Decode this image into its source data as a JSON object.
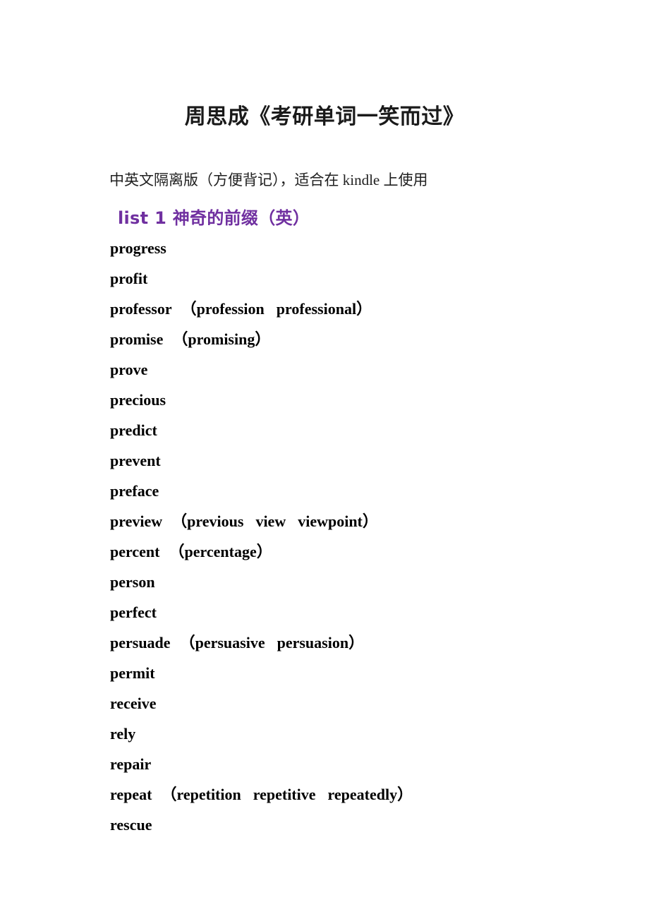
{
  "document": {
    "title": "周思成《考研单词一笑而过》",
    "subtitle": "中英文隔离版（方便背记），适合在 kindle 上使用",
    "section_heading": "list 1 神奇的前缀（英）",
    "heading_color": "#7030a0",
    "title_color": "#1a1a1a",
    "body_color": "#000000",
    "background_color": "#ffffff"
  },
  "word_list": [
    {
      "headword": "progress",
      "related": []
    },
    {
      "headword": "profit",
      "related": []
    },
    {
      "headword": "professor",
      "related": [
        "profession",
        "professional"
      ]
    },
    {
      "headword": "promise",
      "related": [
        "promising"
      ]
    },
    {
      "headword": "prove",
      "related": []
    },
    {
      "headword": "precious",
      "related": []
    },
    {
      "headword": "predict",
      "related": []
    },
    {
      "headword": "prevent",
      "related": []
    },
    {
      "headword": "preface",
      "related": []
    },
    {
      "headword": "preview",
      "related": [
        "previous",
        "view",
        "viewpoint"
      ]
    },
    {
      "headword": "percent",
      "related": [
        "percentage"
      ]
    },
    {
      "headword": "person",
      "related": []
    },
    {
      "headword": "perfect",
      "related": []
    },
    {
      "headword": "persuade",
      "related": [
        "persuasive",
        "persuasion"
      ]
    },
    {
      "headword": "permit",
      "related": []
    },
    {
      "headword": "receive",
      "related": []
    },
    {
      "headword": "rely",
      "related": []
    },
    {
      "headword": "repair",
      "related": []
    },
    {
      "headword": "repeat",
      "related": [
        "repetition",
        "repetitive",
        "repeatedly"
      ]
    },
    {
      "headword": "rescue",
      "related": []
    }
  ],
  "punctuation": {
    "open_paren": "（",
    "close_paren": "）"
  }
}
